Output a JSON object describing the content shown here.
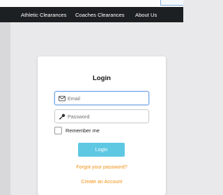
{
  "nav": {
    "links": [
      "Athletic Clearances",
      "Coaches Clearances",
      "About Us"
    ]
  },
  "login": {
    "title": "Login",
    "email_placeholder": "Email",
    "password_placeholder": "Password",
    "remember_label": "Remember me",
    "remember_checked": false,
    "button_label": "Login",
    "forgot_link": "Forgot your password?",
    "create_link": "Create an Account"
  },
  "colors": {
    "navbar": "#1d2023",
    "button": "#5ec8e3",
    "link": "#f29013"
  },
  "icons": {
    "email": "envelope-icon",
    "password": "key-icon"
  }
}
